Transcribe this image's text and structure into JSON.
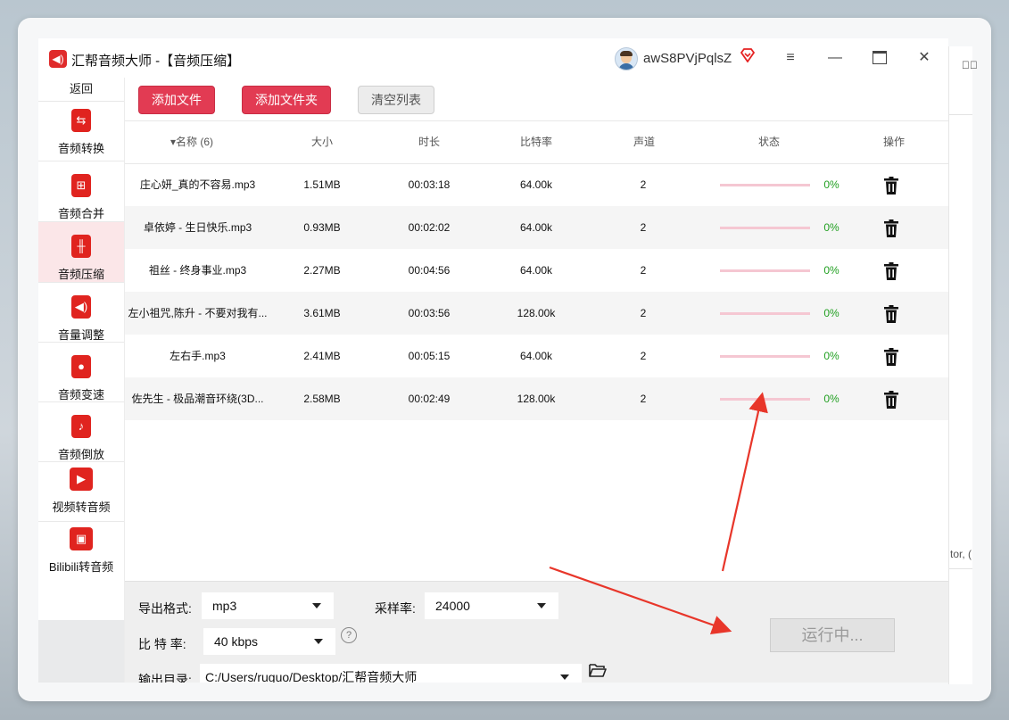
{
  "background_strip": {
    "cut_text": "tor, ("
  },
  "app": {
    "title": "汇帮音频大师  -【音频压缩】",
    "logo_icon": "speaker-icon",
    "username": "awS8PVjPqlsZ",
    "accent_color": "#e23b53"
  },
  "sidebar": {
    "back_label": "返回",
    "items": [
      {
        "label": "音频转换",
        "icon": "audio-convert-icon"
      },
      {
        "label": "音频合并",
        "icon": "audio-merge-icon"
      },
      {
        "label": "音频压缩",
        "icon": "audio-compress-icon",
        "active": true
      },
      {
        "label": "音量调整",
        "icon": "volume-icon"
      },
      {
        "label": "音频变速",
        "icon": "microphone-icon"
      },
      {
        "label": "音频倒放",
        "icon": "music-note-icon"
      },
      {
        "label": "视频转音频",
        "icon": "film-icon"
      },
      {
        "label": "Bilibili转音频",
        "icon": "tv-icon"
      }
    ]
  },
  "toolbar": {
    "add_file": "添加文件",
    "add_folder": "添加文件夹",
    "clear_list": "清空列表"
  },
  "table": {
    "headers": {
      "name": "▾名称 (6)",
      "size": "大小",
      "duration": "时长",
      "bitrate": "比特率",
      "channels": "声道",
      "status": "状态",
      "action": "操作"
    },
    "rows": [
      {
        "name": "庄心妍_真的不容易.mp3",
        "size": "1.51MB",
        "duration": "00:03:18",
        "bitrate": "64.00k",
        "channels": "2",
        "progress_text": "0%",
        "progress": 0
      },
      {
        "name": "卓依婷 - 生日快乐.mp3",
        "size": "0.93MB",
        "duration": "00:02:02",
        "bitrate": "64.00k",
        "channels": "2",
        "progress_text": "0%",
        "progress": 0
      },
      {
        "name": "祖丝 - 终身事业.mp3",
        "size": "2.27MB",
        "duration": "00:04:56",
        "bitrate": "64.00k",
        "channels": "2",
        "progress_text": "0%",
        "progress": 0
      },
      {
        "name": "左小祖咒,陈升 - 不要对我有...",
        "size": "3.61MB",
        "duration": "00:03:56",
        "bitrate": "128.00k",
        "channels": "2",
        "progress_text": "0%",
        "progress": 0
      },
      {
        "name": "左右手.mp3",
        "size": "2.41MB",
        "duration": "00:05:15",
        "bitrate": "64.00k",
        "channels": "2",
        "progress_text": "0%",
        "progress": 0
      },
      {
        "name": "佐先生 - 极品潮音环绕(3D...",
        "size": "2.58MB",
        "duration": "00:02:49",
        "bitrate": "128.00k",
        "channels": "2",
        "progress_text": "0%",
        "progress": 0
      }
    ]
  },
  "settings": {
    "format_label": "导出格式:",
    "format_value": "mp3",
    "samplerate_label": "采样率:",
    "samplerate_value": "24000",
    "bitrate_label": "比 特 率:",
    "bitrate_value": "40 kbps",
    "help_icon": "?",
    "output_label": "输出目录:",
    "output_value": "C:/Users/ruguo/Desktop/汇帮音频大师",
    "run_label": "运行中..."
  },
  "annotation": {
    "arrow_color": "#e8362a"
  }
}
